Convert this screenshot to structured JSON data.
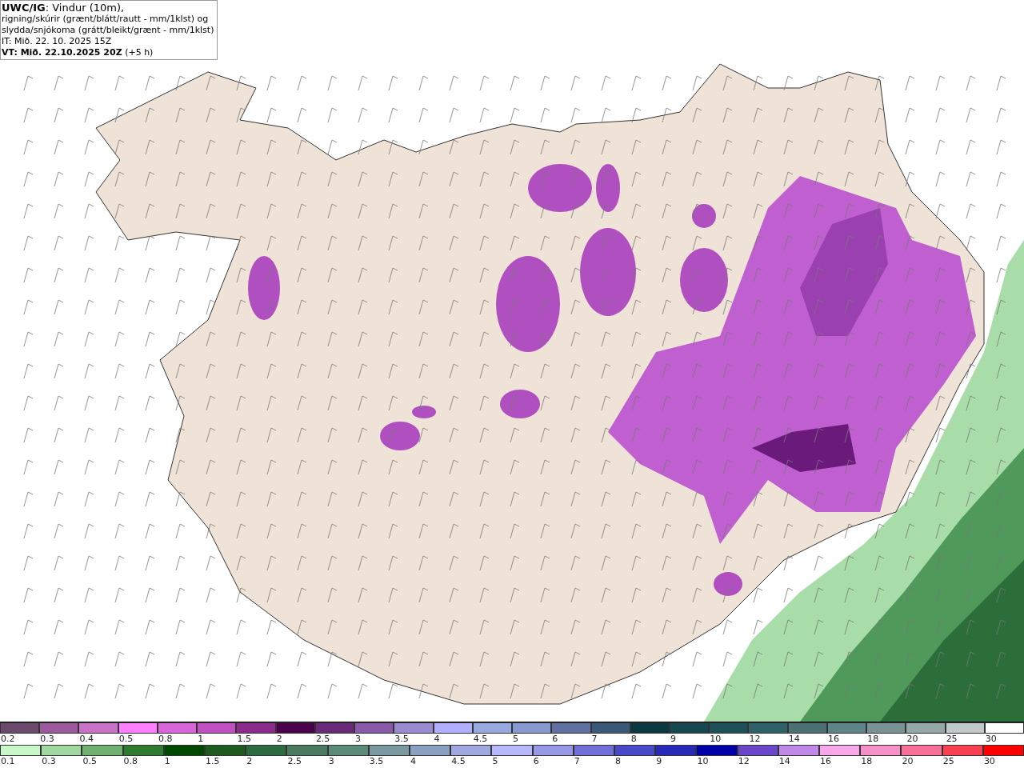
{
  "title_box": {
    "lines": [
      "**UWC/IG**: Vindur (10m),",
      "rigning/skúrir (grænt/blátt/rautt - mm/1klst) og",
      "slydda/snjókoma (grátt/bleikt/grænt - mm/1klst)",
      "IT: Mið. 22. 10. 2025 15Z",
      "**VT: Mið. 22.10.2025 20Z** (+5 h)"
    ]
  },
  "legend_snow": [
    {
      "label": "0.2",
      "color": "#6b4a6b"
    },
    {
      "label": "0.3",
      "color": "#9c5a9c"
    },
    {
      "label": "0.4",
      "color": "#c872c8"
    },
    {
      "label": "0.5",
      "color": "#ff80ff"
    },
    {
      "label": "0.8",
      "color": "#d966d9"
    },
    {
      "label": "1",
      "color": "#c050c0"
    },
    {
      "label": "1.5",
      "color": "#8a2a8a"
    },
    {
      "label": "2",
      "color": "#4a004a"
    },
    {
      "label": "2.5",
      "color": "#6a2a7a"
    },
    {
      "label": "3",
      "color": "#8a5aaa"
    },
    {
      "label": "3.5",
      "color": "#9a8ad0"
    },
    {
      "label": "4",
      "color": "#b0b0ff"
    },
    {
      "label": "4.5",
      "color": "#98a8e0"
    },
    {
      "label": "5",
      "color": "#8898d0"
    },
    {
      "label": "6",
      "color": "#6070a0"
    },
    {
      "label": "7",
      "color": "#3a5878"
    },
    {
      "label": "8",
      "color": "#0a3a40"
    },
    {
      "label": "9",
      "color": "#164850"
    },
    {
      "label": "10",
      "color": "#1e5058"
    },
    {
      "label": "12",
      "color": "#2e6068"
    },
    {
      "label": "14",
      "color": "#4a7074"
    },
    {
      "label": "16",
      "color": "#5e8488"
    },
    {
      "label": "18",
      "color": "#7a9294"
    },
    {
      "label": "20",
      "color": "#94a8a8"
    },
    {
      "label": "25",
      "color": "#c0c8c8"
    },
    {
      "label": "30",
      "color": "#ffffff"
    }
  ],
  "legend_rain": [
    {
      "label": "0.1",
      "color": "#c8f8c8"
    },
    {
      "label": "0.3",
      "color": "#a0d8a0"
    },
    {
      "label": "0.5",
      "color": "#70b070"
    },
    {
      "label": "0.8",
      "color": "#2e7a2e"
    },
    {
      "label": "1",
      "color": "#004800"
    },
    {
      "label": "1.5",
      "color": "#1e5a1e"
    },
    {
      "label": "2",
      "color": "#2e6a40"
    },
    {
      "label": "2.5",
      "color": "#4a7a60"
    },
    {
      "label": "3",
      "color": "#5a8a78"
    },
    {
      "label": "3.5",
      "color": "#7a98a0"
    },
    {
      "label": "4",
      "color": "#8aa0c0"
    },
    {
      "label": "4.5",
      "color": "#a0a8e0"
    },
    {
      "label": "5",
      "color": "#b8b8ff"
    },
    {
      "label": "6",
      "color": "#9898e8"
    },
    {
      "label": "7",
      "color": "#7070d8"
    },
    {
      "label": "8",
      "color": "#4848c8"
    },
    {
      "label": "9",
      "color": "#2828b8"
    },
    {
      "label": "10",
      "color": "#0000a8"
    },
    {
      "label": "12",
      "color": "#6848c8"
    },
    {
      "label": "14",
      "color": "#c088e8"
    },
    {
      "label": "16",
      "color": "#f8a8e8"
    },
    {
      "label": "18",
      "color": "#f890c8"
    },
    {
      "label": "20",
      "color": "#f87098"
    },
    {
      "label": "25",
      "color": "#f84050"
    },
    {
      "label": "30",
      "color": "#ff0000"
    }
  ]
}
